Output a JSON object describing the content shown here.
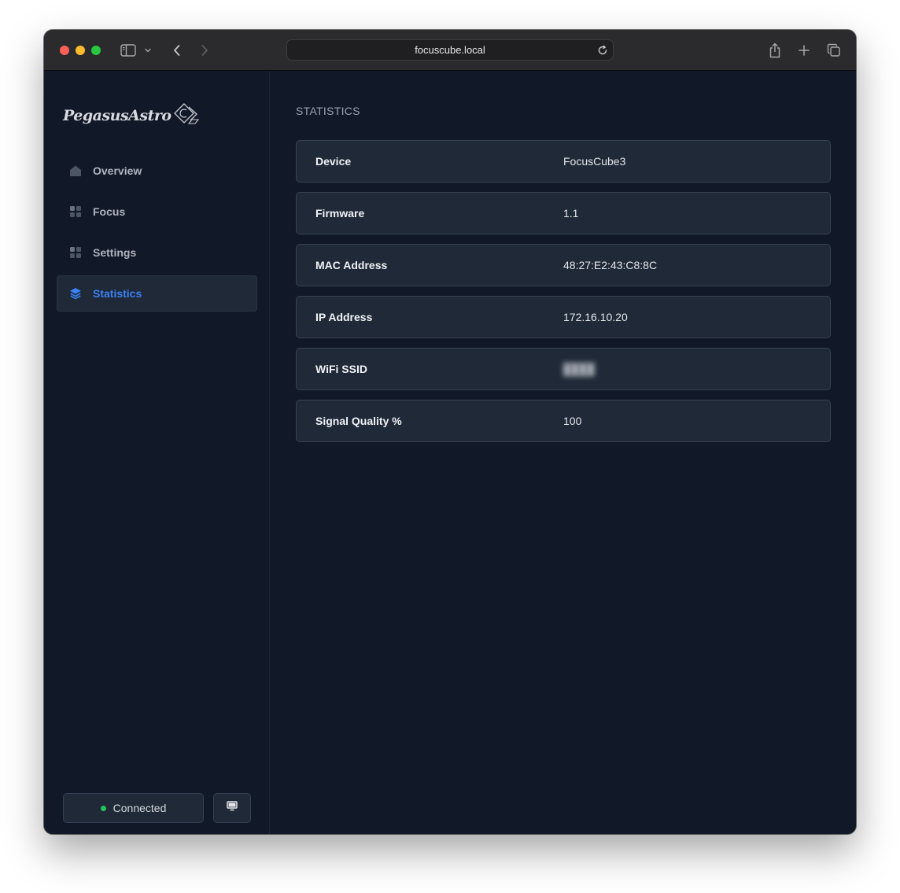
{
  "browser": {
    "url": "focuscube.local"
  },
  "brand": {
    "logo_text": "PegasusAstro"
  },
  "sidebar": {
    "items": [
      {
        "label": "Overview",
        "icon": "home-icon",
        "active": false
      },
      {
        "label": "Focus",
        "icon": "grid-icon",
        "active": false
      },
      {
        "label": "Settings",
        "icon": "grid-icon",
        "active": false
      },
      {
        "label": "Statistics",
        "icon": "layers-icon",
        "active": true
      }
    ],
    "status_label": "Connected",
    "status_color": "#22c55e",
    "display_button_icon": "monitor-icon"
  },
  "main": {
    "title": "STATISTICS",
    "rows": [
      {
        "key": "Device",
        "value": "FocusCube3"
      },
      {
        "key": "Firmware",
        "value": "1.1"
      },
      {
        "key": "MAC Address",
        "value": "48:27:E2:43:C8:8C"
      },
      {
        "key": "IP Address",
        "value": "172.16.10.20"
      },
      {
        "key": "WiFi SSID",
        "value": "████",
        "redacted": true
      },
      {
        "key": "Signal Quality %",
        "value": "100"
      }
    ]
  },
  "colors": {
    "accent": "#3b82f6",
    "background": "#111827",
    "card": "#1f2937"
  }
}
